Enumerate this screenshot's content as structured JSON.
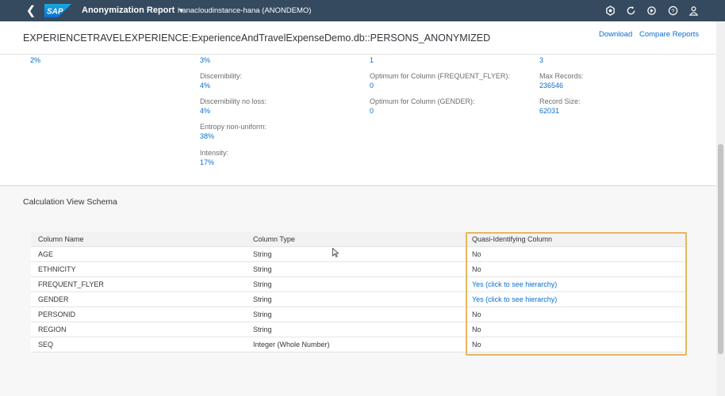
{
  "shell": {
    "brand": "SAP",
    "app_title": "Anonymization Report",
    "instance": "hanacloudinstance-hana (ANONDEMO)",
    "icons": [
      "back-icon",
      "settings-icon",
      "refresh-icon",
      "notifications-icon",
      "help-icon",
      "user-icon"
    ]
  },
  "header": {
    "title": "EXPERIENCETRAVELEXPERIENCE:ExperienceAndTravelExpenseDemo.db::PERSONS_ANONYMIZED",
    "download": "Download",
    "compare": "Compare Reports"
  },
  "stats": {
    "col1": [
      {
        "label": "",
        "value": "2%"
      }
    ],
    "col2": [
      {
        "label": "",
        "value": "3%"
      },
      {
        "label": "Discernibility:",
        "value": "4%"
      },
      {
        "label": "Discernibility no loss:",
        "value": "4%"
      },
      {
        "label": "Entropy non-uniform:",
        "value": "38%"
      },
      {
        "label": "Intensity:",
        "value": "17%"
      }
    ],
    "col3": [
      {
        "label": "",
        "value": "1"
      },
      {
        "label": "Optimum for Column (FREQUENT_FLYER):",
        "value": "0"
      },
      {
        "label": "Optimum for Column (GENDER):",
        "value": "0"
      }
    ],
    "col4": [
      {
        "label": "",
        "value": "3"
      },
      {
        "label": "Max Records:",
        "value": "236546"
      },
      {
        "label": "Record Size:",
        "value": "62031"
      }
    ]
  },
  "schema": {
    "title": "Calculation View Schema",
    "columns": [
      "Column Name",
      "Column Type",
      "Quasi-Identifying Column"
    ],
    "rows": [
      {
        "name": "AGE",
        "type": "String",
        "quasi": "No",
        "link": false
      },
      {
        "name": "ETHNICITY",
        "type": "String",
        "quasi": "No",
        "link": false
      },
      {
        "name": "FREQUENT_FLYER",
        "type": "String",
        "quasi": "Yes (click to see hierarchy)",
        "link": true
      },
      {
        "name": "GENDER",
        "type": "String",
        "quasi": "Yes (click to see hierarchy)",
        "link": true
      },
      {
        "name": "PERSONID",
        "type": "String",
        "quasi": "No",
        "link": false
      },
      {
        "name": "REGION",
        "type": "String",
        "quasi": "No",
        "link": false
      },
      {
        "name": "SEQ",
        "type": "Integer (Whole Number)",
        "quasi": "No",
        "link": false
      }
    ]
  },
  "colors": {
    "shell": "#354a5f",
    "link": "#0a6ed1",
    "highlight": "#e6b75f"
  }
}
